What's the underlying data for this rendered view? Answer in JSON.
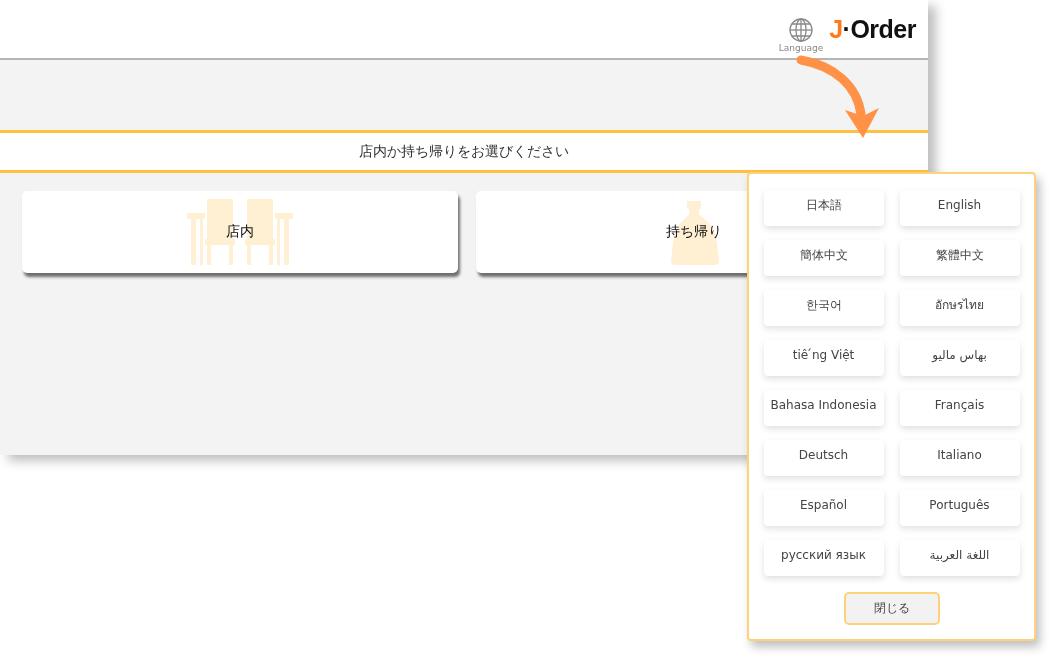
{
  "header": {
    "language_label": "Language",
    "logo": {
      "mark": "J",
      "text": "·Order"
    }
  },
  "prompt": "店内か持ち帰りをお選びください",
  "choices": [
    {
      "label": "店内",
      "kind": "dine-in"
    },
    {
      "label": "持ち帰り",
      "kind": "takeout"
    }
  ],
  "language_popup": {
    "languages": [
      "日本語",
      "English",
      "簡体中文",
      "繁體中文",
      "한국어",
      "อักษรไทย",
      "tiê ́ng Việt",
      "بهاس ماليو",
      "Bahasa Indonesia",
      "Français",
      "Deutsch",
      "Italiano",
      "Español",
      "Português",
      "русский язык",
      "اللغة العربية"
    ],
    "close": "閉じる"
  }
}
